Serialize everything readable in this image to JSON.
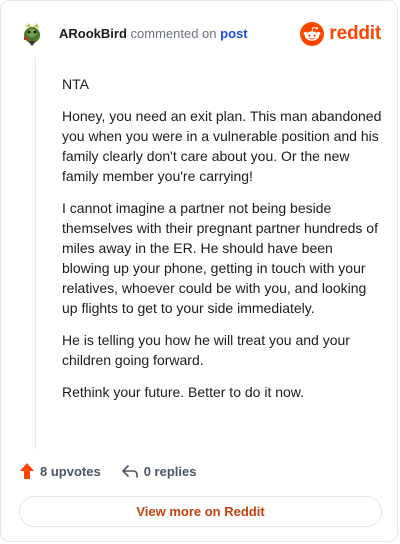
{
  "header": {
    "username": "ARookBird",
    "verb": "commented on",
    "post_link": "post",
    "brand": "reddit"
  },
  "comment": {
    "paragraphs": [
      "NTA",
      "Honey, you need an exit plan. This man abandoned you when you were in a vulnerable position and his family clearly don't care about you. Or the new family member you're carrying!",
      "I cannot imagine a partner not being beside themselves with their pregnant partner hundreds of miles away in the ER. He should have been blowing up your phone, getting in touch with your relatives, whoever could be with you, and looking up flights to get to your side immediately.",
      "He is telling you how he will treat you and your children going forward.",
      "Rethink your future. Better to do it now."
    ]
  },
  "actions": {
    "upvotes": "8 upvotes",
    "replies": "0 replies"
  },
  "footer": {
    "view_more": "View more on Reddit"
  },
  "colors": {
    "brand": "#ff4500",
    "link": "#1d4ed8",
    "cta": "#c2410c"
  }
}
